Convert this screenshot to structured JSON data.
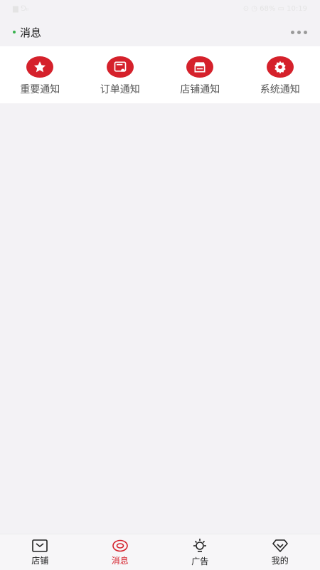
{
  "status_bar": {
    "left": "▆ ⅁ₗₗ",
    "right": "⊙ ◷ 68% ▭ 10:19"
  },
  "header": {
    "title": "消息"
  },
  "notifications": [
    {
      "label": "重要通知",
      "icon": "star-icon"
    },
    {
      "label": "订单通知",
      "icon": "order-bell-icon"
    },
    {
      "label": "店铺通知",
      "icon": "store-icon"
    },
    {
      "label": "系统通知",
      "icon": "gear-icon"
    }
  ],
  "tabbar": {
    "items": [
      {
        "label": "店铺",
        "icon": "store-tab-icon",
        "active": false
      },
      {
        "label": "消息",
        "icon": "message-tab-icon",
        "active": true
      },
      {
        "label": "广告",
        "icon": "bulb-tab-icon",
        "active": false
      },
      {
        "label": "我的",
        "icon": "diamond-tab-icon",
        "active": false
      }
    ]
  },
  "colors": {
    "accent": "#d5212b",
    "background": "#f3f2f5",
    "panel": "#ffffff"
  }
}
